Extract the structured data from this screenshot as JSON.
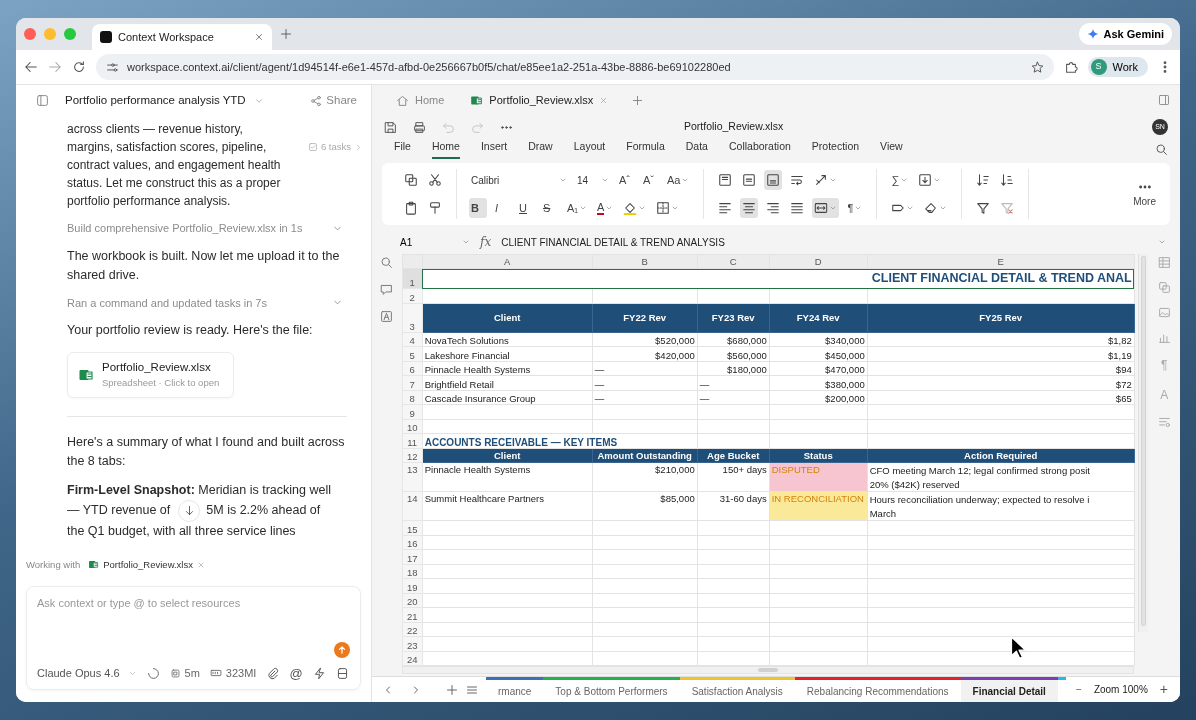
{
  "browser": {
    "tab_title": "Context Workspace",
    "url": "workspace.context.ai/client/agent/1d94514f-e6e1-457d-afbd-0e256667b0f5/chat/e85ee1a2-251a-43be-8886-be69102280ed",
    "gemini": "Ask Gemini",
    "profile_initial": "S",
    "profile": "Work"
  },
  "chat": {
    "title": "Portfolio performance analysis YTD",
    "share": "Share",
    "tasks": "6 tasks",
    "messages": [
      {
        "kind": "text",
        "text": "across clients — revenue history, margins, satisfaction scores, pipeline, contract values, and engagement health status. Let me construct this as a proper portfolio performance analysis."
      },
      {
        "kind": "step",
        "text": "Build comprehensive Portfolio_Review.xlsx in 1s"
      },
      {
        "kind": "text",
        "text": "The workbook is built. Now let me upload it to the shared drive."
      },
      {
        "kind": "step",
        "text": "Ran a command and updated tasks in 7s"
      },
      {
        "kind": "text",
        "text": "Your portfolio review is ready. Here's the file:"
      },
      {
        "kind": "file",
        "name": "Portfolio_Review.xlsx",
        "meta": "Spreadsheet · Click to open"
      },
      {
        "kind": "divider"
      },
      {
        "kind": "text",
        "text": "Here's a summary of what I found and built across the 8 tabs:"
      },
      {
        "kind": "snapshot",
        "lines": [
          "**Firm-Level Snapshot:** Meridian is tracking well",
          "— YTD revenue of",
          "5M is 2.2% ahead of",
          "the Q1 budget, with all three service lines"
        ]
      }
    ],
    "working_label": "Working with",
    "working_file": "Portfolio_Review.xlsx",
    "placeholder": "Ask context or type @ to select resources",
    "model": "Claude Opus 4.6",
    "duration": "5m",
    "memory": "323MI",
    "mention": "@"
  },
  "doc_tabs": [
    {
      "kind": "home",
      "label": "Home",
      "selected": false
    },
    {
      "kind": "file",
      "label": "Portfolio_Review.xlsx",
      "selected": true
    }
  ],
  "quick_tools": [
    {
      "kind": "save",
      "disabled": false
    },
    {
      "kind": "print",
      "disabled": false
    },
    {
      "kind": "undo",
      "disabled": true
    },
    {
      "kind": "redo",
      "disabled": true
    },
    {
      "kind": "more",
      "disabled": false
    }
  ],
  "doc_title": "Portfolio_Review.xlsx",
  "avatar": "SN",
  "menu": [
    {
      "label": "File",
      "selected": false
    },
    {
      "label": "Home",
      "selected": true
    },
    {
      "label": "Insert",
      "selected": false
    },
    {
      "label": "Draw",
      "selected": false
    },
    {
      "label": "Layout",
      "selected": false
    },
    {
      "label": "Formula",
      "selected": false
    },
    {
      "label": "Data",
      "selected": false
    },
    {
      "label": "Collaboration",
      "selected": false
    },
    {
      "label": "Protection",
      "selected": false
    },
    {
      "label": "View",
      "selected": false
    }
  ],
  "ribbon": {
    "groups": [
      {
        "top": [
          {
            "kind": "copy",
            "active": false
          },
          {
            "kind": "cut",
            "active": false
          }
        ],
        "bottom": [
          {
            "kind": "paste",
            "active": false
          },
          {
            "kind": "painter",
            "active": false
          }
        ]
      },
      {
        "top": [
          {
            "kind": "select",
            "value": "Calibri",
            "dropdown": true
          },
          {
            "kind": "select",
            "value": "14",
            "dropdown": true
          },
          {
            "kind": "glyph",
            "text": "Aˆ",
            "active": false
          },
          {
            "kind": "glyph",
            "text": "Aˇ",
            "active": false
          },
          {
            "kind": "glyph",
            "text": "Aa",
            "active": false,
            "dropdown": true
          }
        ],
        "bottom": [
          {
            "kind": "bold",
            "text": "B",
            "active": true
          },
          {
            "kind": "italic",
            "text": "I",
            "active": false
          },
          {
            "kind": "underline",
            "text": "U",
            "active": false
          },
          {
            "kind": "strike",
            "text": "S",
            "active": false
          },
          {
            "kind": "glyph",
            "text": "A₁",
            "active": false,
            "dropdown": true
          },
          {
            "kind": "font-color",
            "text": "A",
            "active": false,
            "dropdown": true
          },
          {
            "kind": "fill-color",
            "active": false,
            "dropdown": true
          },
          {
            "kind": "borders",
            "active": false,
            "dropdown": true
          }
        ]
      },
      {
        "top": [
          {
            "kind": "align-top",
            "active": false
          },
          {
            "kind": "align-middle",
            "active": false
          },
          {
            "kind": "align-bottom",
            "active": true
          },
          {
            "kind": "wrap",
            "active": false
          },
          {
            "kind": "orientation",
            "active": false,
            "dropdown": true
          }
        ],
        "bottom": [
          {
            "kind": "align-left",
            "active": false
          },
          {
            "kind": "align-center",
            "active": true
          },
          {
            "kind": "align-right",
            "active": false
          },
          {
            "kind": "justify",
            "active": false
          },
          {
            "kind": "merge",
            "active": true,
            "dropdown": true
          },
          {
            "kind": "glyph",
            "text": "¶",
            "active": false,
            "dropdown": true
          }
        ]
      },
      {
        "top": [
          {
            "kind": "glyph",
            "text": "∑",
            "active": false,
            "dropdown": true
          },
          {
            "kind": "fill-down",
            "active": false,
            "dropdown": true
          }
        ],
        "bottom": [
          {
            "kind": "tag",
            "active": false,
            "dropdown": true
          },
          {
            "kind": "eraser",
            "active": false,
            "dropdown": true
          }
        ]
      },
      {
        "top": [
          {
            "kind": "sort-asc",
            "active": false
          },
          {
            "kind": "sort-desc",
            "active": false
          }
        ],
        "bottom": [
          {
            "kind": "filter",
            "active": false
          },
          {
            "kind": "clear-filter",
            "active": false
          }
        ]
      }
    ],
    "more": "More"
  },
  "sheet": {
    "name_box": "A1",
    "fx_label": "fx",
    "formula": "CLIENT FINANCIAL DETAIL & TREND ANALYSIS",
    "columns": [
      "A",
      "B",
      "C",
      "D",
      "E"
    ],
    "side_tools": [
      {
        "kind": "search"
      },
      {
        "kind": "comment"
      },
      {
        "kind": "text-box"
      }
    ],
    "right_tools": [
      {
        "kind": "table"
      },
      {
        "kind": "copy"
      },
      {
        "kind": "image"
      },
      {
        "kind": "chart"
      },
      {
        "kind": "glyph",
        "text": "¶"
      },
      {
        "kind": "glyph",
        "text": "A"
      },
      {
        "kind": "list"
      }
    ],
    "rows": [
      {
        "num": "1",
        "kind": "title",
        "cells": [
          "CLIENT FINANCIAL DETAIL & TREND ANAL"
        ]
      },
      {
        "num": "2",
        "kind": "blank"
      },
      {
        "num": "3",
        "kind": "header",
        "cells": [
          "Client",
          "FY22 Rev",
          "FY23 Rev",
          "FY24 Rev",
          "FY25 Rev"
        ]
      },
      {
        "num": "4",
        "kind": "data",
        "cells": [
          "NovaTech Solutions",
          "$520,000",
          "$680,000",
          "$340,000",
          "$1,82"
        ]
      },
      {
        "num": "5",
        "kind": "data",
        "cells": [
          "Lakeshore Financial",
          "$420,000",
          "$560,000",
          "$450,000",
          "$1,19"
        ]
      },
      {
        "num": "6",
        "kind": "data",
        "cells": [
          "Pinnacle Health Systems",
          {
            "kind": "dash",
            "text": "—"
          },
          "$180,000",
          "$470,000",
          "$94"
        ]
      },
      {
        "num": "7",
        "kind": "data",
        "cells": [
          "Brightfield Retail",
          {
            "kind": "dash",
            "text": "—"
          },
          {
            "kind": "dash",
            "text": "—"
          },
          "$380,000",
          "$72"
        ]
      },
      {
        "num": "8",
        "kind": "data",
        "cells": [
          "Cascade Insurance Group",
          {
            "kind": "dash",
            "text": "—"
          },
          {
            "kind": "dash",
            "text": "—"
          },
          "$200,000",
          "$65"
        ]
      },
      {
        "num": "9",
        "kind": "blank"
      },
      {
        "num": "10",
        "kind": "blank"
      },
      {
        "num": "11",
        "kind": "section",
        "cells": [
          "ACCOUNTS RECEIVABLE — KEY ITEMS"
        ]
      },
      {
        "num": "12",
        "kind": "header",
        "cells": [
          "Client",
          "Amount Outstanding",
          "Age Bucket",
          "Status",
          "Action Required"
        ]
      },
      {
        "num": "13",
        "kind": "ar",
        "cells": [
          "Pinnacle Health Systems",
          "$210,000",
          "150+ days"
        ],
        "status": {
          "text": "DISPUTED",
          "color": "#f6c5cf"
        },
        "action_lines": [
          "CFO meeting March 12; legal confirmed strong posit",
          "20% ($42K) reserved"
        ]
      },
      {
        "num": "14",
        "kind": "ar",
        "cells": [
          "Summit Healthcare Partners",
          "$85,000",
          "31-60 days"
        ],
        "status": {
          "text": "IN RECONCILIATION",
          "color": "#fbe99a"
        },
        "action_lines": [
          "Hours reconciliation underway; expected to resolve i",
          "March"
        ]
      },
      {
        "num": "15",
        "kind": "blank"
      },
      {
        "num": "16",
        "kind": "blank"
      },
      {
        "num": "17",
        "kind": "blank"
      },
      {
        "num": "18",
        "kind": "blank"
      },
      {
        "num": "19",
        "kind": "blank"
      },
      {
        "num": "20",
        "kind": "blank"
      },
      {
        "num": "21",
        "kind": "blank"
      },
      {
        "num": "22",
        "kind": "blank"
      },
      {
        "num": "23",
        "kind": "blank"
      },
      {
        "num": "24",
        "kind": "blank"
      }
    ]
  },
  "sheet_tabs": [
    {
      "label": "rmance",
      "color": "#3d6fb6",
      "selected": false
    },
    {
      "label": "Top & Bottom Performers",
      "color": "#22b14c",
      "selected": false
    },
    {
      "label": "Satisfaction Analysis",
      "color": "#f2c12e",
      "selected": false
    },
    {
      "label": "Rebalancing Recommendations",
      "color": "#e5202e",
      "selected": false
    },
    {
      "label": "Financial Detail",
      "color": "#7b3fb5",
      "selected": true
    },
    {
      "color": "#29b6e8",
      "selected": false
    }
  ],
  "zoom": {
    "minus": "−",
    "label": "Zoom 100%",
    "plus": "+"
  }
}
